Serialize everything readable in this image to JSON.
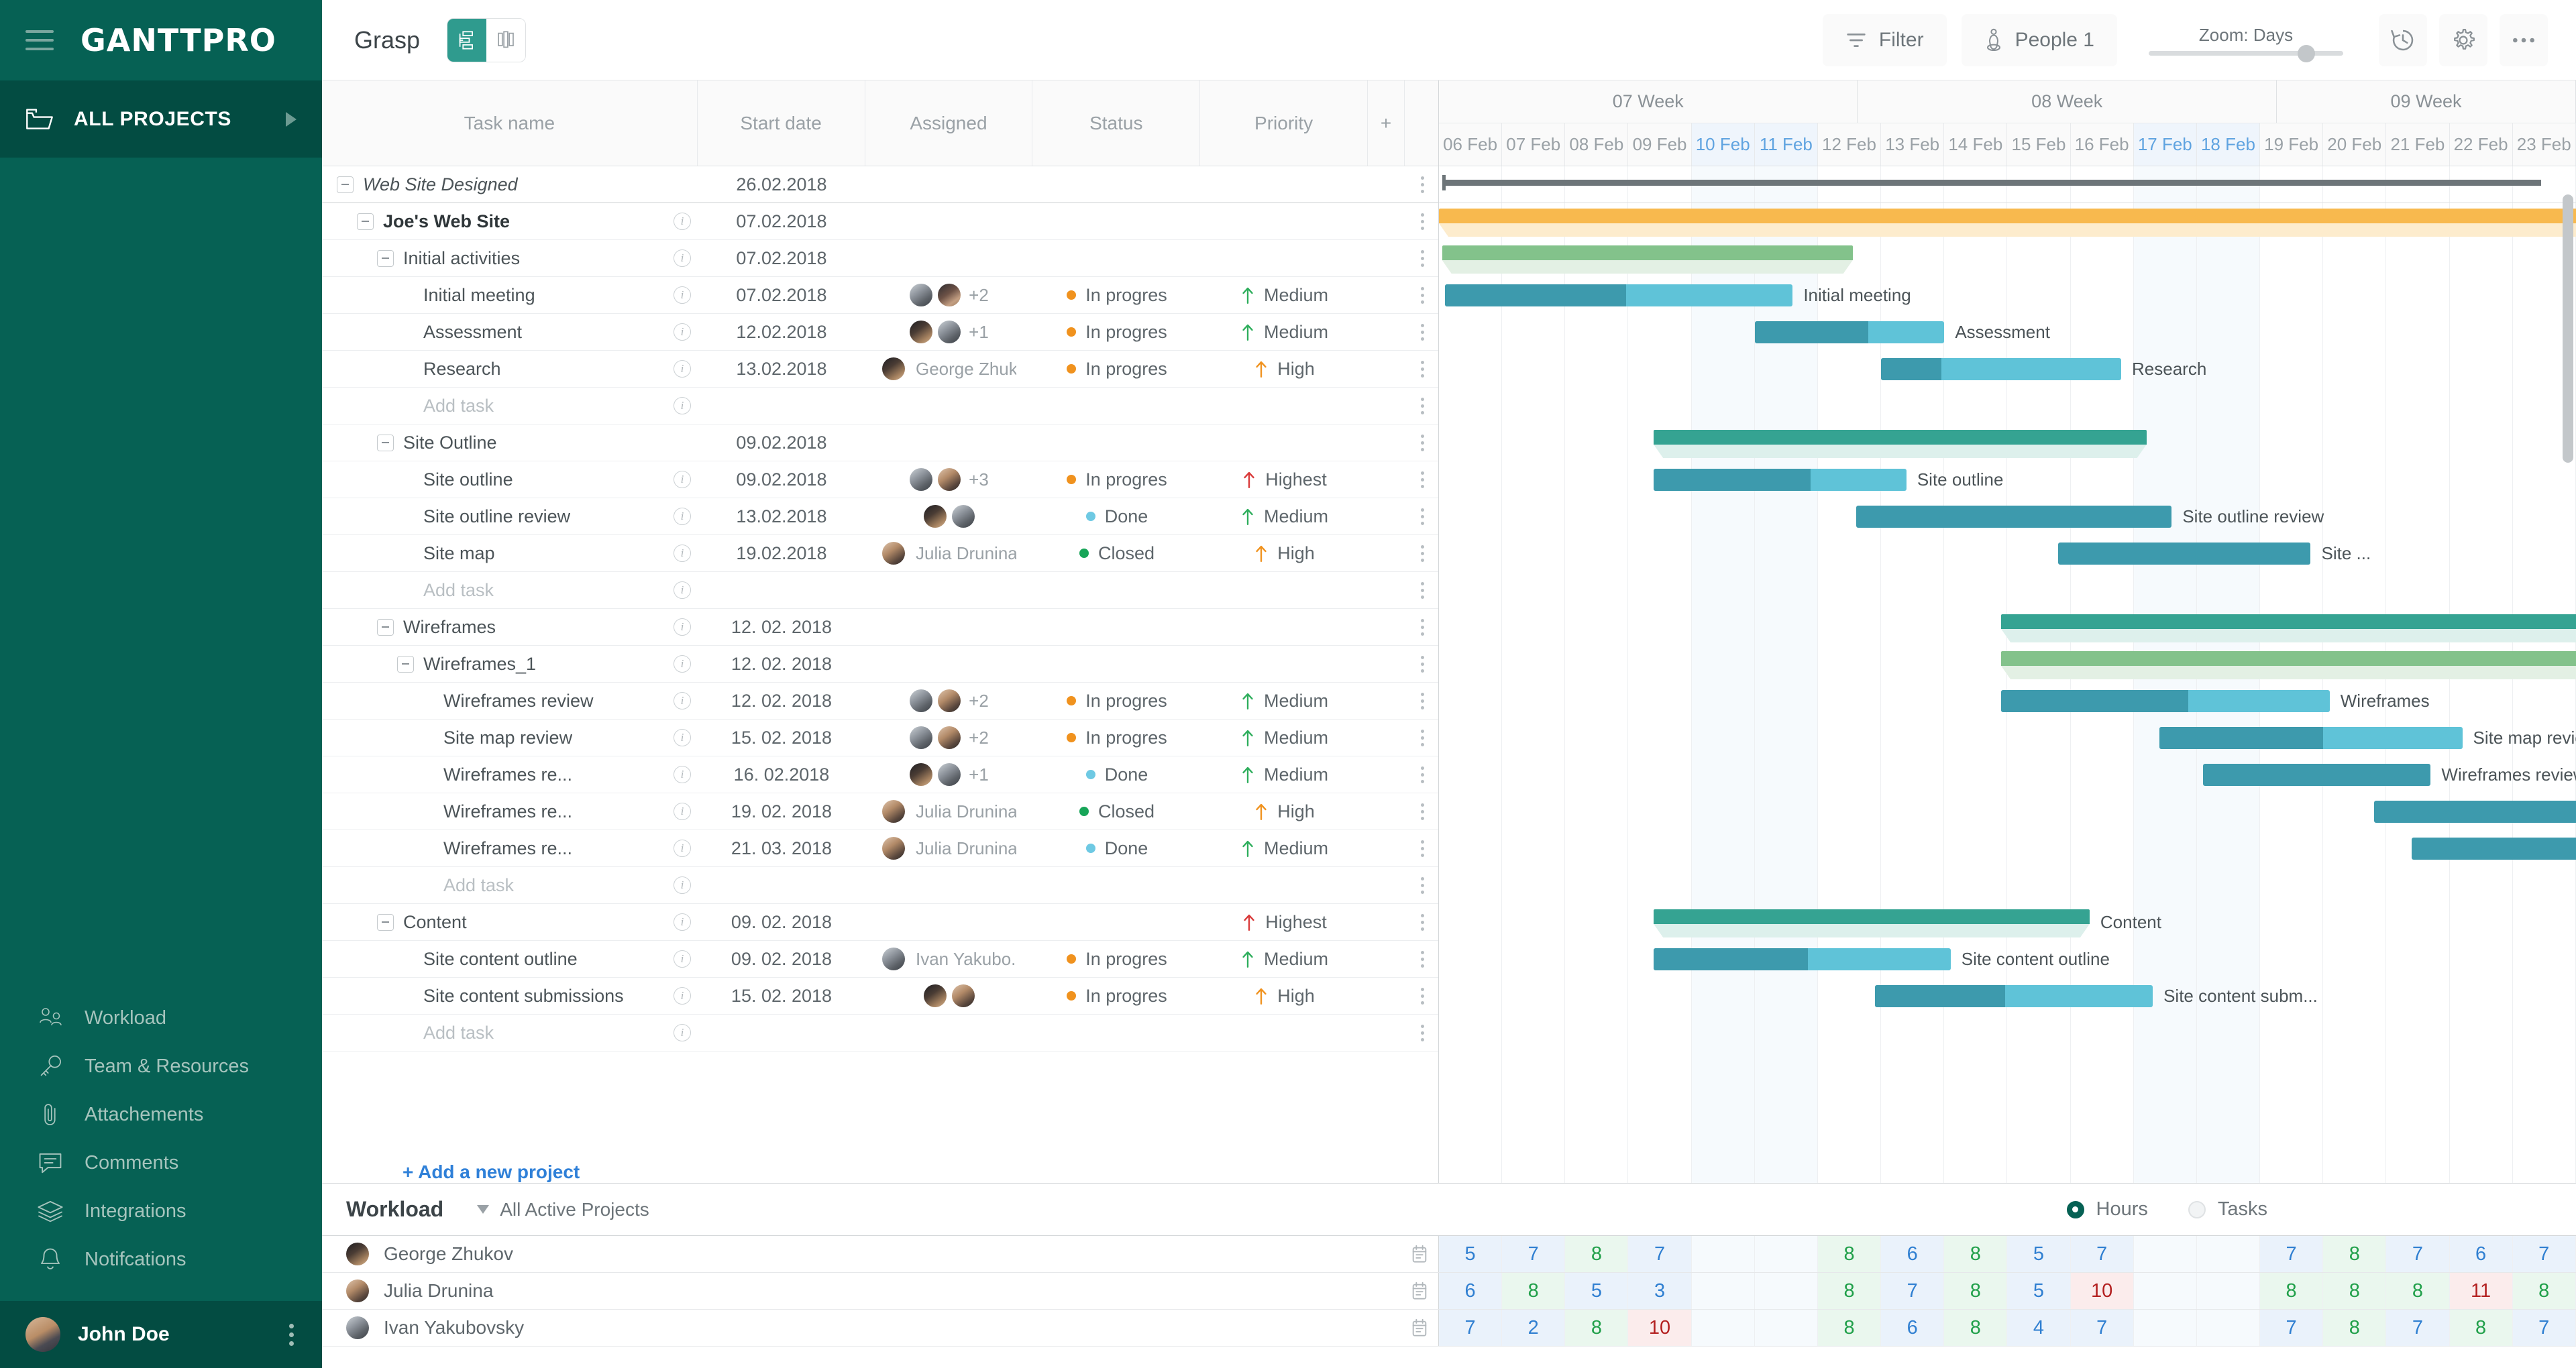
{
  "sidebar": {
    "logo": "GANTTPRO",
    "all_projects": "ALL PROJECTS",
    "items": [
      {
        "label": "Workload",
        "icon": "people-icon"
      },
      {
        "label": "Team & Resources",
        "icon": "key-icon"
      },
      {
        "label": "Attachements",
        "icon": "paperclip-icon"
      },
      {
        "label": "Comments",
        "icon": "comment-icon"
      },
      {
        "label": "Integrations",
        "icon": "layers-icon"
      },
      {
        "label": "Notifcations",
        "icon": "bell-icon"
      }
    ],
    "user": "John Doe"
  },
  "topbar": {
    "project_title": "Grasp",
    "filter": "Filter",
    "people": "People 1",
    "zoom_label": "Zoom: Days",
    "zoom_value": 77,
    "icons": [
      "gantt-view-icon",
      "board-view-icon",
      "filter-icon",
      "people-icon",
      "history-icon",
      "gear-icon",
      "more-icon"
    ]
  },
  "grid": {
    "columns": [
      "Task name",
      "Start date",
      "Assigned",
      "Status",
      "Priority"
    ],
    "add_column": "+",
    "add_project": "+ Add a new project",
    "rows": [
      {
        "name": "Web Site Designed",
        "level": 0,
        "style": "lvl0",
        "collapse": true,
        "info": false,
        "date": "26.02.2018",
        "assignees": [],
        "more": "",
        "person": "",
        "status": "",
        "priority": ""
      },
      {
        "name": "Joe's Web Site",
        "level": 1,
        "style": "lvl1",
        "collapse": true,
        "info": true,
        "date": "07.02.2018",
        "assignees": [],
        "more": "",
        "person": "",
        "status": "",
        "priority": ""
      },
      {
        "name": "Initial activities",
        "level": 2,
        "style": "",
        "collapse": true,
        "info": true,
        "date": "07.02.2018",
        "assignees": [],
        "more": "",
        "person": "",
        "status": "",
        "priority": ""
      },
      {
        "name": "Initial meeting",
        "level": 3,
        "style": "",
        "collapse": false,
        "info": true,
        "date": "07.02.2018",
        "assignees": [
          "a",
          "b"
        ],
        "more": "+2",
        "person": "",
        "status": "In progres",
        "priority": "Medium"
      },
      {
        "name": "Assessment",
        "level": 3,
        "style": "",
        "collapse": false,
        "info": true,
        "date": "12.02.2018",
        "assignees": [
          "d",
          "a"
        ],
        "more": "+1",
        "person": "",
        "status": "In progres",
        "priority": "Medium"
      },
      {
        "name": "Research",
        "level": 3,
        "style": "",
        "collapse": false,
        "info": true,
        "date": "13.02.2018",
        "assignees": [
          "d"
        ],
        "more": "",
        "person": "George Zhuk...",
        "status": "In progres",
        "priority": "High"
      },
      {
        "name": "Add task",
        "level": 3,
        "style": "add",
        "collapse": false,
        "info": true,
        "date": "",
        "assignees": [],
        "more": "",
        "person": "",
        "status": "",
        "priority": ""
      },
      {
        "name": "Site Outline",
        "level": 2,
        "style": "",
        "collapse": true,
        "info": false,
        "date": "09.02.2018",
        "assignees": [],
        "more": "",
        "person": "",
        "status": "",
        "priority": ""
      },
      {
        "name": "Site outline",
        "level": 3,
        "style": "",
        "collapse": false,
        "info": true,
        "date": "09.02.2018",
        "assignees": [
          "a",
          "c"
        ],
        "more": "+3",
        "person": "",
        "status": "In progres",
        "priority": "Highest"
      },
      {
        "name": "Site outline review",
        "level": 3,
        "style": "",
        "collapse": false,
        "info": true,
        "date": "13.02.2018",
        "assignees": [
          "d",
          "a"
        ],
        "more": "",
        "person": "",
        "status": "Done",
        "priority": "Medium"
      },
      {
        "name": "Site map",
        "level": 3,
        "style": "",
        "collapse": false,
        "info": true,
        "date": "19.02.2018",
        "assignees": [
          "c"
        ],
        "more": "",
        "person": "Julia Drunina",
        "status": "Closed",
        "priority": "High"
      },
      {
        "name": "Add task",
        "level": 3,
        "style": "add",
        "collapse": false,
        "info": true,
        "date": "",
        "assignees": [],
        "more": "",
        "person": "",
        "status": "",
        "priority": ""
      },
      {
        "name": "Wireframes",
        "level": 2,
        "style": "",
        "collapse": true,
        "info": true,
        "date": "12. 02. 2018",
        "assignees": [],
        "more": "",
        "person": "",
        "status": "",
        "priority": ""
      },
      {
        "name": "Wireframes_1",
        "level": 3,
        "style": "",
        "collapse": true,
        "info": true,
        "date": "12. 02. 2018",
        "assignees": [],
        "more": "",
        "person": "",
        "status": "",
        "priority": ""
      },
      {
        "name": "Wireframes review",
        "level": 4,
        "style": "",
        "collapse": false,
        "info": true,
        "date": "12. 02. 2018",
        "assignees": [
          "a",
          "c"
        ],
        "more": "+2",
        "person": "",
        "status": "In progres",
        "priority": "Medium"
      },
      {
        "name": "Site map review",
        "level": 4,
        "style": "",
        "collapse": false,
        "info": true,
        "date": "15. 02. 2018",
        "assignees": [
          "a",
          "c"
        ],
        "more": "+2",
        "person": "",
        "status": "In progres",
        "priority": "Medium"
      },
      {
        "name": "Wireframes re...",
        "level": 4,
        "style": "",
        "collapse": false,
        "info": true,
        "date": "16. 02.2018",
        "assignees": [
          "d",
          "a"
        ],
        "more": "+1",
        "person": "",
        "status": "Done",
        "priority": "Medium"
      },
      {
        "name": "Wireframes re...",
        "level": 4,
        "style": "",
        "collapse": false,
        "info": true,
        "date": "19. 02. 2018",
        "assignees": [
          "c"
        ],
        "more": "",
        "person": "Julia Drunina",
        "status": "Closed",
        "priority": "High"
      },
      {
        "name": "Wireframes re...",
        "level": 4,
        "style": "",
        "collapse": false,
        "info": true,
        "date": "21. 03. 2018",
        "assignees": [
          "c"
        ],
        "more": "",
        "person": "Julia Drunina",
        "status": "Done",
        "priority": "Medium"
      },
      {
        "name": "Add task",
        "level": 4,
        "style": "add",
        "collapse": false,
        "info": true,
        "date": "",
        "assignees": [],
        "more": "",
        "person": "",
        "status": "",
        "priority": ""
      },
      {
        "name": "Content",
        "level": 2,
        "style": "",
        "collapse": true,
        "info": true,
        "date": "09. 02. 2018",
        "assignees": [],
        "more": "",
        "person": "",
        "status": "",
        "priority": "Highest"
      },
      {
        "name": "Site content outline",
        "level": 3,
        "style": "",
        "collapse": false,
        "info": true,
        "date": "09. 02. 2018",
        "assignees": [
          "a"
        ],
        "more": "",
        "person": "Ivan Yakubo...",
        "status": "In progres",
        "priority": "Medium"
      },
      {
        "name": "Site content submissions",
        "level": 3,
        "style": "",
        "collapse": false,
        "info": true,
        "date": "15. 02. 2018",
        "assignees": [
          "d",
          "c"
        ],
        "more": "",
        "person": "",
        "status": "In progres",
        "priority": "High"
      },
      {
        "name": "Add task",
        "level": 3,
        "style": "add",
        "collapse": false,
        "info": true,
        "date": "",
        "assignees": [],
        "more": "",
        "person": "",
        "status": "",
        "priority": ""
      }
    ]
  },
  "status_colors": {
    "In progres": "#f0921e",
    "Done": "#6ec9e3",
    "Closed": "#17a558"
  },
  "priority_colors": {
    "Highest": "#d93a3a",
    "High": "#f0921e",
    "Medium": "#2eae5c"
  },
  "timeline": {
    "weeks": [
      {
        "label": "07 Week",
        "days": 7
      },
      {
        "label": "08 Week",
        "days": 7
      },
      {
        "label": "09 Week",
        "days": 5
      }
    ],
    "days": [
      {
        "label": "06 Feb",
        "weekend": false
      },
      {
        "label": "07 Feb",
        "weekend": false
      },
      {
        "label": "08 Feb",
        "weekend": false
      },
      {
        "label": "09 Feb",
        "weekend": false
      },
      {
        "label": "10 Feb",
        "weekend": true
      },
      {
        "label": "11 Feb",
        "weekend": true
      },
      {
        "label": "12 Feb",
        "weekend": false
      },
      {
        "label": "13 Feb",
        "weekend": false
      },
      {
        "label": "14 Feb",
        "weekend": false
      },
      {
        "label": "15 Feb",
        "weekend": false
      },
      {
        "label": "16 Feb",
        "weekend": false
      },
      {
        "label": "17 Feb",
        "weekend": true
      },
      {
        "label": "18 Feb",
        "weekend": true
      },
      {
        "label": "19 Feb",
        "weekend": false
      },
      {
        "label": "20 Feb",
        "weekend": false
      },
      {
        "label": "21 Feb",
        "weekend": false
      },
      {
        "label": "22 Feb",
        "weekend": false
      },
      {
        "label": "23 Feb",
        "weekend": false
      }
    ],
    "bars": [
      {
        "row": 0,
        "type": "project",
        "start": 0.05,
        "span": 17.4,
        "label": "",
        "progress": 0
      },
      {
        "row": 1,
        "type": "summary",
        "start": 0.0,
        "span": 18.2,
        "label": "",
        "color": "#f8b94e",
        "shadow": "#fdeccd"
      },
      {
        "row": 2,
        "type": "summary",
        "start": 0.05,
        "span": 6.5,
        "label": "",
        "color": "#83c28b",
        "shadow": "#e3f0e4"
      },
      {
        "row": 3,
        "type": "task",
        "start": 0.1,
        "span": 5.5,
        "label": "Initial meeting",
        "progress": 0.52
      },
      {
        "row": 4,
        "type": "task",
        "start": 5.0,
        "span": 3.0,
        "label": "Assessment",
        "progress": 0.6
      },
      {
        "row": 5,
        "type": "task",
        "start": 7.0,
        "span": 3.8,
        "label": "Research",
        "progress": 0.25
      },
      {
        "row": 7,
        "type": "summary",
        "start": 3.4,
        "span": 7.8,
        "label": "",
        "color": "#35a392",
        "shadow": "#ddf0ec"
      },
      {
        "row": 8,
        "type": "task",
        "start": 3.4,
        "span": 4.0,
        "label": "Site outline",
        "progress": 0.62
      },
      {
        "row": 9,
        "type": "task",
        "start": 6.6,
        "span": 5.0,
        "label": "Site outline review",
        "progress": 0.0
      },
      {
        "row": 10,
        "type": "task",
        "start": 9.8,
        "span": 4.0,
        "label": "Site ...",
        "progress": 0.0
      },
      {
        "row": 12,
        "type": "summary",
        "start": 8.9,
        "span": 9.3,
        "label": "",
        "color": "#35a392",
        "shadow": "#ddf0ec"
      },
      {
        "row": 13,
        "type": "summary",
        "start": 8.9,
        "span": 9.3,
        "label": "",
        "color": "#83c28b",
        "shadow": "#e3f0e4"
      },
      {
        "row": 14,
        "type": "task",
        "start": 8.9,
        "span": 5.2,
        "label": "Wireframes",
        "progress": 0.57
      },
      {
        "row": 15,
        "type": "task",
        "start": 11.4,
        "span": 4.8,
        "label": "Site map review",
        "progress": 0.54
      },
      {
        "row": 16,
        "type": "task",
        "start": 12.1,
        "span": 3.6,
        "label": "Wireframes review",
        "progress": 0.0
      },
      {
        "row": 17,
        "type": "task",
        "start": 14.8,
        "span": 4.0,
        "label": "",
        "progress": 0.0
      },
      {
        "row": 18,
        "type": "task",
        "start": 15.4,
        "span": 3.4,
        "label": "",
        "progress": 0.0
      },
      {
        "row": 20,
        "type": "summary",
        "start": 3.4,
        "span": 6.9,
        "label": "Content",
        "color": "#35a392",
        "shadow": "#ddf0ec"
      },
      {
        "row": 21,
        "type": "task",
        "start": 3.4,
        "span": 4.7,
        "label": "Site content outline",
        "progress": 0.52
      },
      {
        "row": 22,
        "type": "task",
        "start": 6.9,
        "span": 4.4,
        "label": "Site content subm...",
        "progress": 0.47
      }
    ]
  },
  "workload": {
    "title": "Workload",
    "filter": "All Active Projects",
    "mode_hours": "Hours",
    "mode_tasks": "Tasks",
    "selected_mode": "Hours",
    "people": [
      {
        "name": "George Zhukov",
        "avatar": "d",
        "hours": [
          "5",
          "7",
          "8",
          "7",
          "",
          "",
          "8",
          "6",
          "8",
          "5",
          "7",
          "",
          "",
          "7",
          "8",
          "7",
          "6",
          "7"
        ]
      },
      {
        "name": "Julia Drunina",
        "avatar": "c",
        "hours": [
          "6",
          "8",
          "5",
          "3",
          "",
          "",
          "8",
          "7",
          "8",
          "5",
          "10",
          "",
          "",
          "8",
          "8",
          "8",
          "11",
          "8"
        ]
      },
      {
        "name": "Ivan Yakubovsky",
        "avatar": "a",
        "hours": [
          "7",
          "2",
          "8",
          "10",
          "",
          "",
          "8",
          "6",
          "8",
          "4",
          "7",
          "",
          "",
          "7",
          "8",
          "7",
          "8",
          "7"
        ]
      }
    ]
  }
}
